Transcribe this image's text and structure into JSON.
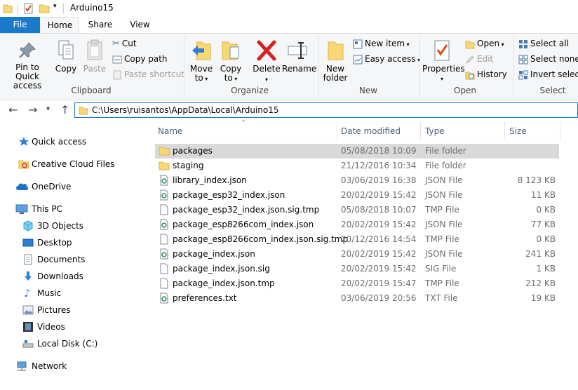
{
  "window": {
    "title": "Arduino15"
  },
  "tabs": {
    "file": "File",
    "home": "Home",
    "share": "Share",
    "view": "View"
  },
  "ribbon": {
    "clipboard": {
      "label": "Clipboard",
      "pin": [
        "Pin to Quick",
        "access"
      ],
      "copy": "Copy",
      "paste": "Paste",
      "cut": "Cut",
      "copy_path": "Copy path",
      "paste_shortcut": "Paste shortcut"
    },
    "organize": {
      "label": "Organize",
      "move_to": [
        "Move",
        "to"
      ],
      "copy_to": [
        "Copy",
        "to"
      ],
      "delete": "Delete",
      "rename": "Rename"
    },
    "new": {
      "label": "New",
      "new_folder": [
        "New",
        "folder"
      ],
      "new_item": "New item",
      "easy_access": "Easy access"
    },
    "open": {
      "label": "Open",
      "properties": "Properties",
      "open": "Open",
      "edit": "Edit",
      "history": "History"
    },
    "select": {
      "label": "Select",
      "select_all": "Select all",
      "select_none": "Select none",
      "invert": "Invert selection"
    }
  },
  "address": {
    "path": "C:\\Users\\ruisantos\\AppData\\Local\\Arduino15"
  },
  "nav": {
    "quick_access": "Quick access",
    "creative_cloud": "Creative Cloud Files",
    "onedrive": "OneDrive",
    "this_pc": "This PC",
    "objects3d": "3D Objects",
    "desktop": "Desktop",
    "documents": "Documents",
    "downloads": "Downloads",
    "music": "Music",
    "pictures": "Pictures",
    "videos": "Videos",
    "local_disk": "Local Disk (C:)",
    "network": "Network"
  },
  "columns": {
    "name": "Name",
    "date": "Date modified",
    "type": "Type",
    "size": "Size"
  },
  "files": [
    {
      "name": "packages",
      "date": "05/08/2018 10:09",
      "type": "File folder",
      "size": "",
      "kind": "folder"
    },
    {
      "name": "staging",
      "date": "21/12/2016 10:34",
      "type": "File folder",
      "size": "",
      "kind": "folder"
    },
    {
      "name": "library_index.json",
      "date": "03/06/2019 16:38",
      "type": "JSON File",
      "size": "8 123 KB",
      "kind": "json"
    },
    {
      "name": "package_esp32_index.json",
      "date": "20/02/2019 15:42",
      "type": "JSON File",
      "size": "11 KB",
      "kind": "json"
    },
    {
      "name": "package_esp32_index.json.sig.tmp",
      "date": "05/08/2018 10:07",
      "type": "TMP File",
      "size": "0 KB",
      "kind": "doc"
    },
    {
      "name": "package_esp8266com_index.json",
      "date": "20/02/2019 15:42",
      "type": "JSON File",
      "size": "77 KB",
      "kind": "json"
    },
    {
      "name": "package_esp8266com_index.json.sig.tmp",
      "date": "20/12/2016 14:54",
      "type": "TMP File",
      "size": "0 KB",
      "kind": "doc"
    },
    {
      "name": "package_index.json",
      "date": "20/02/2019 15:42",
      "type": "JSON File",
      "size": "241 KB",
      "kind": "json"
    },
    {
      "name": "package_index.json.sig",
      "date": "20/02/2019 15:42",
      "type": "SIG File",
      "size": "1 KB",
      "kind": "doc"
    },
    {
      "name": "package_index.json.tmp",
      "date": "20/02/2019 15:47",
      "type": "TMP File",
      "size": "212 KB",
      "kind": "doc"
    },
    {
      "name": "preferences.txt",
      "date": "03/06/2019 20:56",
      "type": "TXT File",
      "size": "19 KB",
      "kind": "json"
    }
  ]
}
